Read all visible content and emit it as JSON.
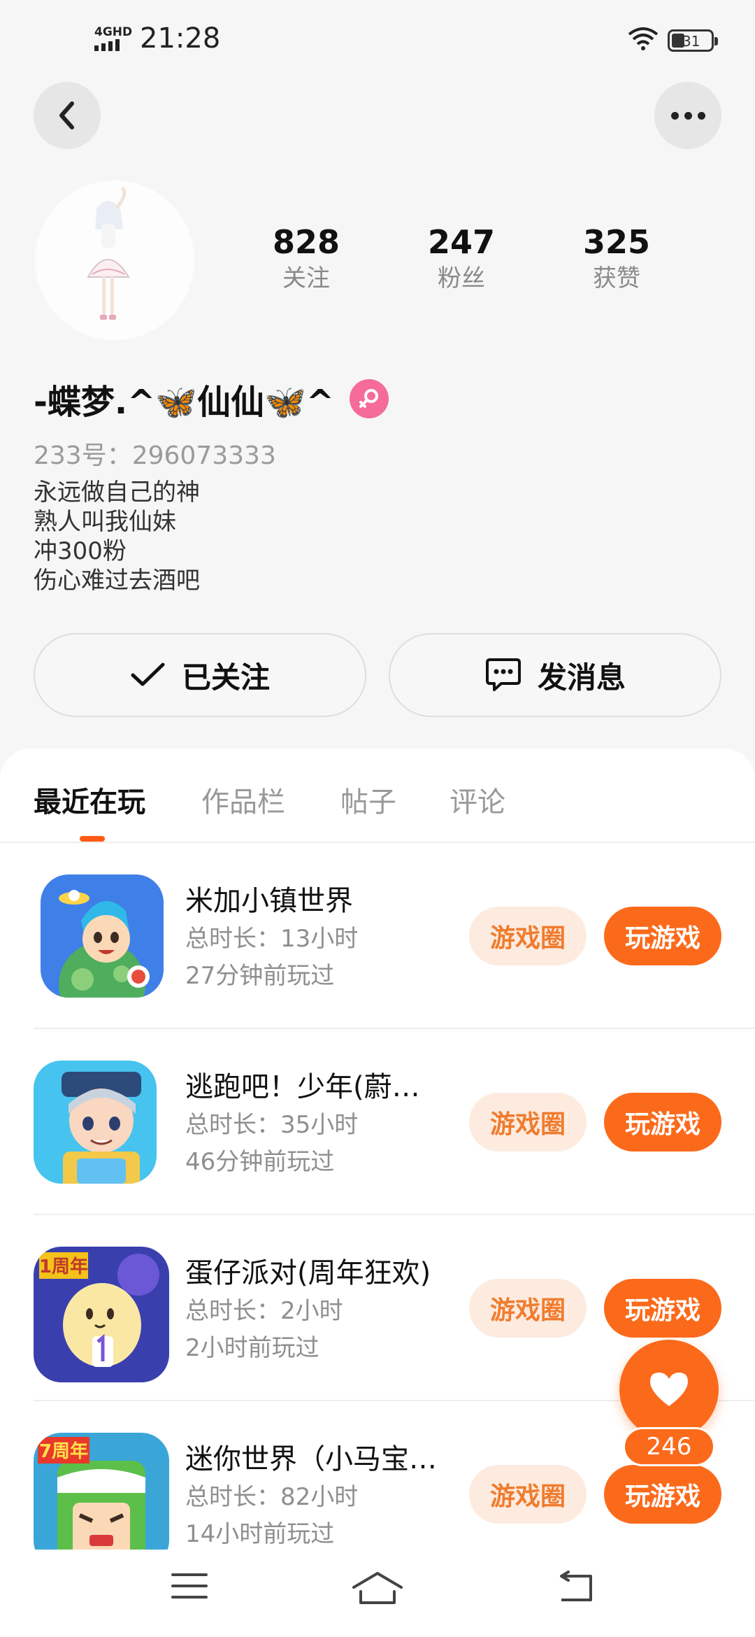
{
  "status_bar": {
    "network": "4GHD",
    "time": "21:28",
    "battery": "31"
  },
  "profile": {
    "stats": [
      {
        "value": "828",
        "label": "关注"
      },
      {
        "value": "247",
        "label": "粉丝"
      },
      {
        "value": "325",
        "label": "获赞"
      }
    ],
    "username": "-蝶梦.^🦋仙仙🦋^",
    "user_id": "233号：296073333",
    "bio": [
      "永远做自己的神",
      "熟人叫我仙妹",
      "冲300粉",
      "伤心难过去酒吧"
    ]
  },
  "actions": {
    "followed_label": "已关注",
    "message_label": "发消息"
  },
  "tabs": [
    {
      "label": "最近在玩",
      "active": true
    },
    {
      "label": "作品栏",
      "active": false
    },
    {
      "label": "帖子",
      "active": false
    },
    {
      "label": "评论",
      "active": false
    }
  ],
  "games": [
    {
      "title": "米加小镇世界",
      "duration": "总时长：13小时",
      "last_played": "27分钟前玩过",
      "circle_label": "游戏圈",
      "play_label": "玩游戏",
      "icon": "toca-world-game-icon"
    },
    {
      "title": "逃跑吧！少年(蔚…",
      "duration": "总时长：35小时",
      "last_played": "46分钟前玩过",
      "circle_label": "游戏圈",
      "play_label": "玩游戏",
      "icon": "escape-boy-game-icon"
    },
    {
      "title": "蛋仔派对(周年狂欢)",
      "duration": "总时长：2小时",
      "last_played": "2小时前玩过",
      "circle_label": "游戏圈",
      "play_label": "玩游戏",
      "icon": "eggy-party-game-icon",
      "icon_badge": "1周年"
    },
    {
      "title": "迷你世界（小马宝…",
      "duration": "总时长：82小时",
      "last_played": "14小时前玩过",
      "circle_label": "游戏圈",
      "play_label": "玩游戏",
      "icon": "mini-world-game-icon",
      "icon_badge": "7周年"
    }
  ],
  "floating_like": {
    "count": "246"
  },
  "colors": {
    "accent": "#fb6a1b",
    "chip_bg": "#fdebe0",
    "chip_text": "#f07c2e",
    "gender": "#f56b9a"
  }
}
